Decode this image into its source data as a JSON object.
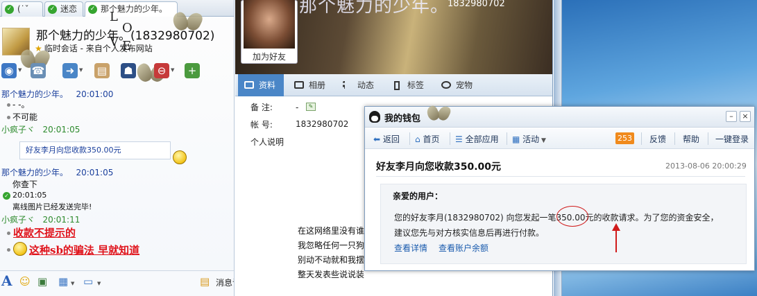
{
  "chat_window": {
    "tabs": [
      {
        "label": "(˙ˇ"
      },
      {
        "label": "迷恋"
      },
      {
        "label": "那个魅力的少年。"
      }
    ],
    "contact_name": "那个魅力的少年。(1832980702)",
    "subtitle": "临时会话 - 来自个人发布网站",
    "love_letters": [
      "L",
      "O",
      "V",
      "E"
    ],
    "messages": [
      {
        "sender": "那个魅力的少年。",
        "time": "20:01:00",
        "lines": [
          "- -。",
          "不可能"
        ]
      },
      {
        "sender": "小疯子ヾ",
        "time": "20:01:05",
        "bubble": "好友李月向您收款350.00元"
      },
      {
        "sender": "那个魅力的少年。",
        "time": "20:01:05",
        "lines": [
          "你查下"
        ]
      },
      {
        "system_time": "20:01:05",
        "system_text": "离线图片已经发送完毕!"
      },
      {
        "sender": "小疯子ヾ",
        "time": "20:01:11"
      }
    ],
    "red_lines": [
      "收款不提示的",
      "这种sb的骗法  早就知道"
    ],
    "bottom_label": "消息记"
  },
  "profile_window": {
    "name": "那个魅力的少年。",
    "qq_number": "1832980702",
    "add_friend_label": "加为好友",
    "tabs": [
      "资料",
      "相册",
      "动态",
      "标签",
      "宠物"
    ],
    "fields": [
      {
        "label": "备    注:",
        "value": "-"
      },
      {
        "label": "帐    号:",
        "value": "1832980702"
      },
      {
        "label": "个人说明",
        "value": ""
      }
    ],
    "poem_lines": [
      "在这网络里没有谁",
      "我忽略任何一只狗",
      "别动不动就和我摆",
      "整天发表些说说装"
    ]
  },
  "wallet": {
    "title": "我的钱包",
    "nav": {
      "back": "返回",
      "home": "首页",
      "all_apps": "全部应用",
      "activity": "活动",
      "badge": "253",
      "feedback": "反馈",
      "help": "帮助",
      "login": "一键登录"
    },
    "heading": "好友李月向您收款350.00元",
    "date": "2013-08-06 20:00:29",
    "greeting": "亲爱的用户：",
    "body_line1_pre": "您的好友李月(1832980702) 向您发起一笔",
    "amount": "350.00",
    "body_line1_post": "元的收款请求。为了您的资金安全，",
    "body_line2": "建议您先与对方核实信息后再进行付款。",
    "link_details": "查看详情",
    "link_balance": "查看账户余额"
  }
}
